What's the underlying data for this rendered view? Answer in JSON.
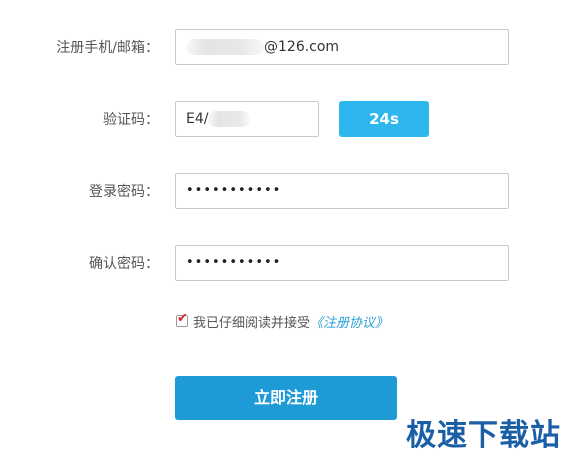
{
  "form": {
    "email_label": "注册手机/邮箱：",
    "email_value_suffix": "@126.com",
    "code_label": "验证码：",
    "code_value_prefix": "E4/",
    "countdown_label": "24s",
    "password_label": "登录密码：",
    "password_value": "•••••••••••",
    "confirm_label": "确认密码：",
    "confirm_value": "•••••••••••",
    "agree_text": "我已仔细阅读并接受",
    "agree_link": "《注册协议》",
    "agree_checked": true,
    "submit_label": "立即注册"
  },
  "watermark": "极速下载站",
  "colors": {
    "accent": "#1e9bd7",
    "countdown": "#2eb7ef",
    "link": "#2a9fd8",
    "checkmark": "#d9261c"
  }
}
